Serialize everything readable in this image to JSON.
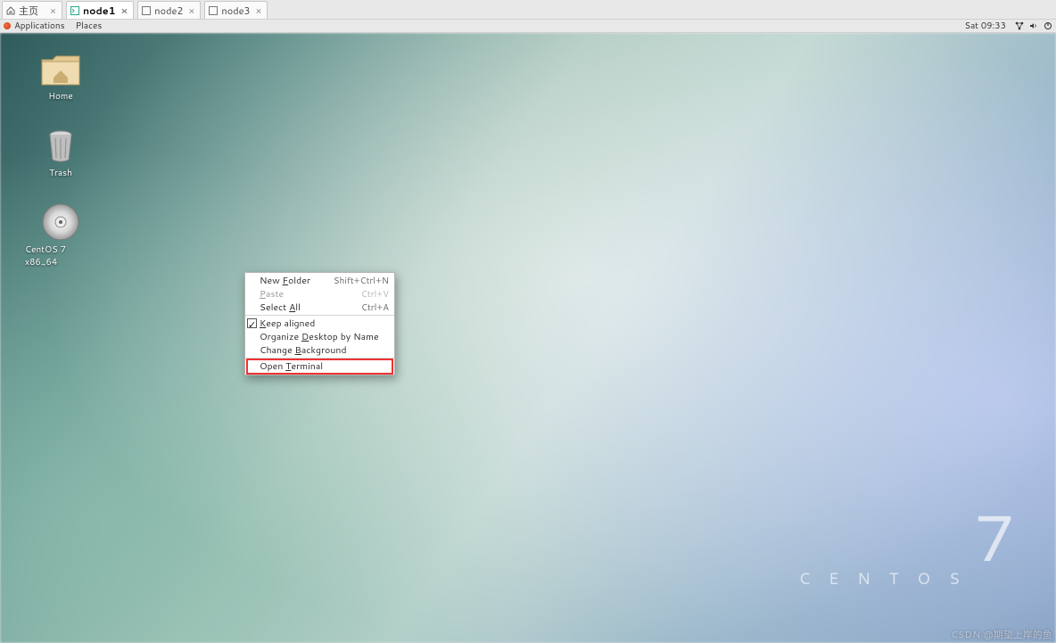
{
  "tabs": {
    "home": {
      "label": "主页"
    },
    "node1": {
      "label": "node1"
    },
    "node2": {
      "label": "node2"
    },
    "node3": {
      "label": "node3"
    }
  },
  "panel": {
    "applications": "Applications",
    "places": "Places",
    "clock": "Sat 09:33"
  },
  "desktop_icons": {
    "home": "Home",
    "trash": "Trash",
    "disc": "CentOS 7 x86_64"
  },
  "context_menu": {
    "new_folder": {
      "pre": "New ",
      "u": "F",
      "post": "older",
      "shortcut": "Shift+Ctrl+N"
    },
    "paste": {
      "pre": "",
      "u": "P",
      "post": "aste",
      "shortcut": "Ctrl+V"
    },
    "select_all": {
      "pre": "Select ",
      "u": "A",
      "post": "ll",
      "shortcut": "Ctrl+A"
    },
    "keep_aligned": {
      "pre": "",
      "u": "K",
      "post": "eep aligned"
    },
    "organize": {
      "pre": "Organize ",
      "u": "D",
      "post": "esktop by Name"
    },
    "change_bg": {
      "pre": "Change ",
      "u": "B",
      "post": "ackground"
    },
    "open_terminal": {
      "pre": "Open ",
      "u": "T",
      "post": "erminal"
    }
  },
  "branding": {
    "seven": "7",
    "name": "C E N T O S"
  },
  "watermark": "CSDN @期望上岸的鱼"
}
